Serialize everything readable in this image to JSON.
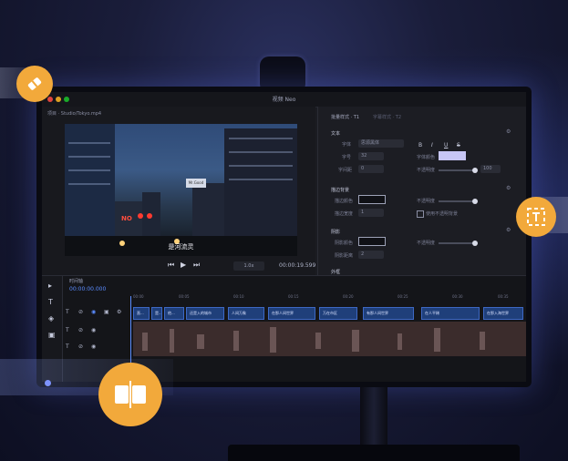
{
  "window": {
    "title": "视频 Neo"
  },
  "project": {
    "path": "项目 · Studio/Tokyo.mp4"
  },
  "preview": {
    "subtitle": "是河流灵",
    "sign_text": "NO",
    "building_sign": "Mr.Good",
    "timecode": "00:00:19.599",
    "zoom": "1.0x",
    "play_icon": "▶",
    "prev_icon": "⏮",
    "next_icon": "⏭"
  },
  "panel": {
    "tabs": [
      {
        "label": "批量样式 · T1"
      },
      {
        "label": "字幕样式 · T2"
      }
    ],
    "text_section": {
      "title": "文本",
      "font_label": "字体",
      "font_value": "思源黑体",
      "size_label": "字号",
      "size_value": "32",
      "spacing_label": "字间距",
      "spacing_value": "0",
      "color_label": "字体颜色",
      "opacity_label": "不透明度",
      "opacity_value": "100"
    },
    "format_buttons": [
      "B",
      "I",
      "U",
      "S"
    ],
    "bg_section": {
      "title": "描边背景",
      "color_label": "描边颜色",
      "width_label": "描边宽度",
      "width_value": "1",
      "opacity_label": "不透明度",
      "checkbox_label": "使用不透明背景"
    },
    "shadow_section": {
      "title": "阴影",
      "color_label": "阴影颜色",
      "distance_label": "阴影距离",
      "distance_value": "2",
      "opacity_label": "不透明度"
    },
    "last_section": {
      "title": "外框"
    }
  },
  "timeline": {
    "label": "时间轴",
    "timecode": "00:00:00.000",
    "ruler_marks": [
      "00:00",
      "00:05",
      "00:10",
      "00:15",
      "00:20",
      "00:25",
      "00:30",
      "00:35"
    ],
    "clips": [
      {
        "label": "直..."
      },
      {
        "label": "是..."
      },
      {
        "label": "他..."
      },
      {
        "label": "还是入的城市"
      },
      {
        "label": "人间万象"
      },
      {
        "label": "在那人间世界"
      },
      {
        "label": "万在市区"
      },
      {
        "label": "有那人间世界"
      },
      {
        "label": "在人平稀"
      },
      {
        "label": "在那入海世界"
      }
    ]
  },
  "colors": {
    "accent": "#5b8cff",
    "badge": "#f2a93b",
    "clip": "#1f3f7a"
  }
}
